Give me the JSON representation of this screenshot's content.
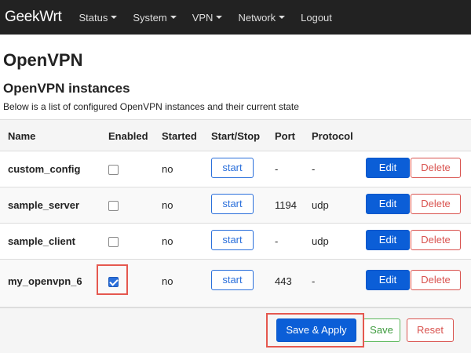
{
  "navbar": {
    "brand": "GeekWrt",
    "menu": [
      {
        "label": "Status",
        "has_caret": true
      },
      {
        "label": "System",
        "has_caret": true
      },
      {
        "label": "VPN",
        "has_caret": true
      },
      {
        "label": "Network",
        "has_caret": true
      },
      {
        "label": "Logout",
        "has_caret": false
      }
    ]
  },
  "page": {
    "title": "OpenVPN",
    "section_title": "OpenVPN instances",
    "section_description": "Below is a list of configured OpenVPN instances and their current state"
  },
  "table": {
    "headers": {
      "name": "Name",
      "enabled": "Enabled",
      "started": "Started",
      "startstop": "Start/Stop",
      "port": "Port",
      "protocol": "Protocol"
    },
    "rows": [
      {
        "name": "custom_config",
        "enabled": false,
        "started": "no",
        "action": "start",
        "port": "-",
        "protocol": "-",
        "edit": "Edit",
        "delete": "Delete"
      },
      {
        "name": "sample_server",
        "enabled": false,
        "started": "no",
        "action": "start",
        "port": "1194",
        "protocol": "udp",
        "edit": "Edit",
        "delete": "Delete"
      },
      {
        "name": "sample_client",
        "enabled": false,
        "started": "no",
        "action": "start",
        "port": "-",
        "protocol": "udp",
        "edit": "Edit",
        "delete": "Delete"
      },
      {
        "name": "my_openvpn_6",
        "enabled": true,
        "started": "no",
        "action": "start",
        "port": "443",
        "protocol": "-",
        "edit": "Edit",
        "delete": "Delete"
      }
    ]
  },
  "footer": {
    "save_apply_label": "Save & Apply",
    "save_label": "Save",
    "reset_label": "Reset"
  },
  "colors": {
    "navbar_bg": "#222222",
    "primary": "#0b5ed7",
    "danger": "#d9534f",
    "success": "#5cb85c",
    "highlight": "#e5584f"
  },
  "icons": {
    "menu_caret": "chevron-down-icon",
    "enabled_checkbox": "checkbox-icon"
  }
}
